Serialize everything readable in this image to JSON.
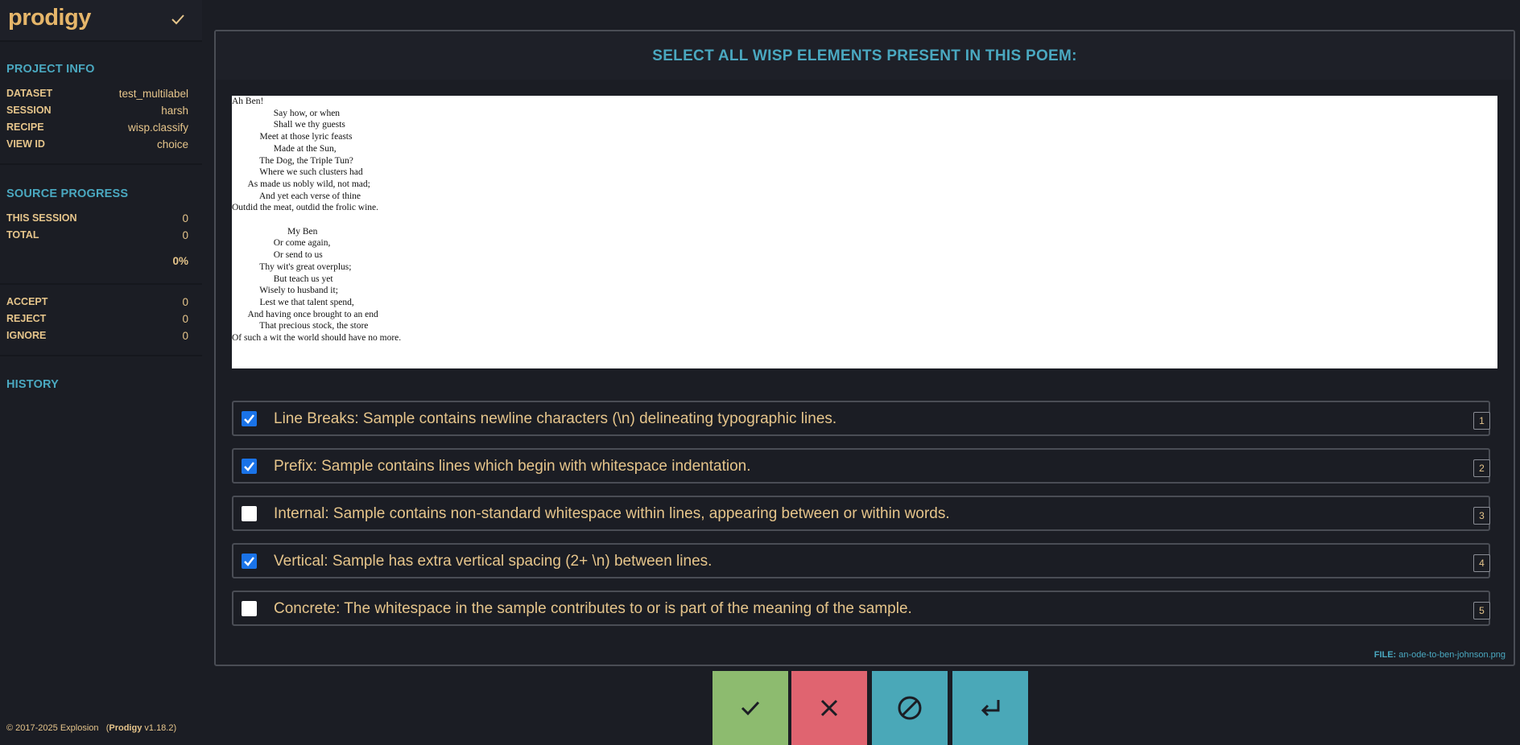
{
  "app": {
    "name": "prodigy"
  },
  "project_info": {
    "title": "PROJECT INFO",
    "rows": [
      {
        "key": "DATASET",
        "value": "test_multilabel"
      },
      {
        "key": "SESSION",
        "value": "harsh"
      },
      {
        "key": "RECIPE",
        "value": "wisp.classify"
      },
      {
        "key": "VIEW ID",
        "value": "choice"
      }
    ]
  },
  "source_progress": {
    "title": "SOURCE PROGRESS",
    "this_session_label": "THIS SESSION",
    "this_session": "0",
    "total_label": "TOTAL",
    "total": "0",
    "percent": "0%"
  },
  "counts": {
    "accept_label": "ACCEPT",
    "accept": "0",
    "reject_label": "REJECT",
    "reject": "0",
    "ignore_label": "IGNORE",
    "ignore": "0"
  },
  "history": {
    "title": "HISTORY"
  },
  "footer": {
    "copyright": "© 2017-2025 Explosion",
    "product": "Prodigy",
    "version": "v1.18.2"
  },
  "task": {
    "title": "SELECT ALL WISP ELEMENTS PRESENT IN THIS POEM:",
    "poem_lines": [
      "Ah Ben!",
      "                  Say how, or when",
      "                  Shall we thy guests",
      "            Meet at those lyric feasts",
      "                  Made at the Sun,",
      "            The Dog, the Triple Tun?",
      "            Where we such clusters had",
      "       As made us nobly wild, not mad;",
      "            And yet each verse of thine",
      "Outdid the meat, outdid the frolic wine.",
      "",
      "                        My Ben",
      "                  Or come again,",
      "                  Or send to us",
      "            Thy wit's great overplus;",
      "                  But teach us yet",
      "            Wisely to husband it;",
      "            Lest we that talent spend,",
      "       And having once brought to an end",
      "            That precious stock, the store",
      "Of such a wit the world should have no more."
    ],
    "options": [
      {
        "label": "Line Breaks: Sample contains newline characters (\\n) delineating typographic lines.",
        "checked": true,
        "key": "1"
      },
      {
        "label": "Prefix: Sample contains lines which begin with whitespace indentation.",
        "checked": true,
        "key": "2"
      },
      {
        "label": "Internal: Sample contains non-standard whitespace within lines, appearing between or within words.",
        "checked": false,
        "key": "3"
      },
      {
        "label": "Vertical: Sample has extra vertical spacing (2+ \\n) between lines.",
        "checked": true,
        "key": "4"
      },
      {
        "label": "Concrete: The whitespace in the sample contributes to or is part of the meaning of the sample.",
        "checked": false,
        "key": "5"
      }
    ],
    "file_label": "FILE:",
    "file_name": "an-ode-to-ben-johnson.png"
  },
  "actions": {
    "accept_icon": "check-icon",
    "reject_icon": "close-icon",
    "ignore_icon": "ban-icon",
    "undo_icon": "undo-icon",
    "colors": {
      "accept": "#8dbb6f",
      "reject": "#e06470",
      "ignore": "#4aa8b8",
      "undo": "#4aa8b8"
    }
  }
}
